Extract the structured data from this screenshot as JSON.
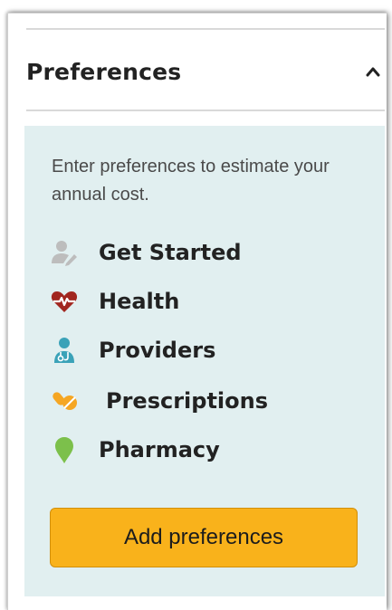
{
  "panel": {
    "title": "Preferences",
    "collapse_icon": "chevron-up-icon",
    "description": "Enter preferences to estimate your annual cost.",
    "items": [
      {
        "label": "Get Started",
        "icon": "user-edit-icon",
        "color": "#bdbdbd"
      },
      {
        "label": "Health",
        "icon": "heart-pulse-icon",
        "color": "#a1261f"
      },
      {
        "label": "Providers",
        "icon": "doctor-icon",
        "color": "#3aa2b8"
      },
      {
        "label": "Prescriptions",
        "icon": "pills-icon",
        "color": "#f5a623"
      },
      {
        "label": "Pharmacy",
        "icon": "map-pin-icon",
        "color": "#7cc04b"
      }
    ],
    "button_label": "Add preferences",
    "colors": {
      "content_bg": "#e1eff0",
      "button_bg": "#f9b21b",
      "button_border": "#d28f0a"
    }
  }
}
